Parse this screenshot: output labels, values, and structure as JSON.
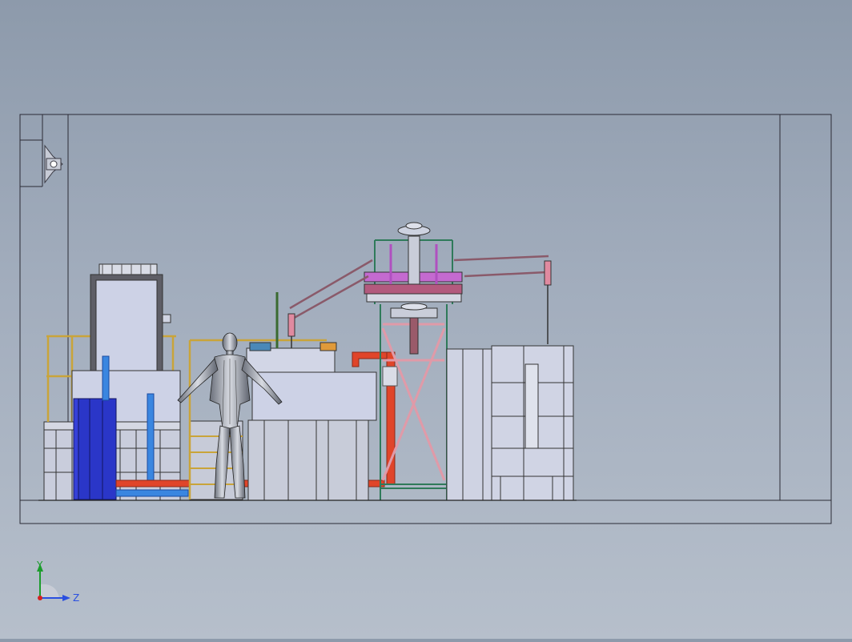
{
  "viewport": {
    "background_top": "#8d9aab",
    "background_bottom": "#b6bfcb",
    "outline_color": "#2b2b35"
  },
  "triad": {
    "y_label": "Y",
    "z_label": "Z",
    "y_color": "#1c9c2c",
    "z_color": "#2a4fe0",
    "x_color": "#d42020"
  },
  "colors": {
    "yellow_rail": "#c9a43a",
    "blue_pipe": "#3a86e0",
    "red_pipe": "#e0452a",
    "heat_exchanger": "#2a36c8",
    "tower_green": "#2f7a5a",
    "magenta_frame": "#b050c0",
    "pink_brace": "#e09aa8",
    "tank_fill": "#cdd2e6"
  }
}
